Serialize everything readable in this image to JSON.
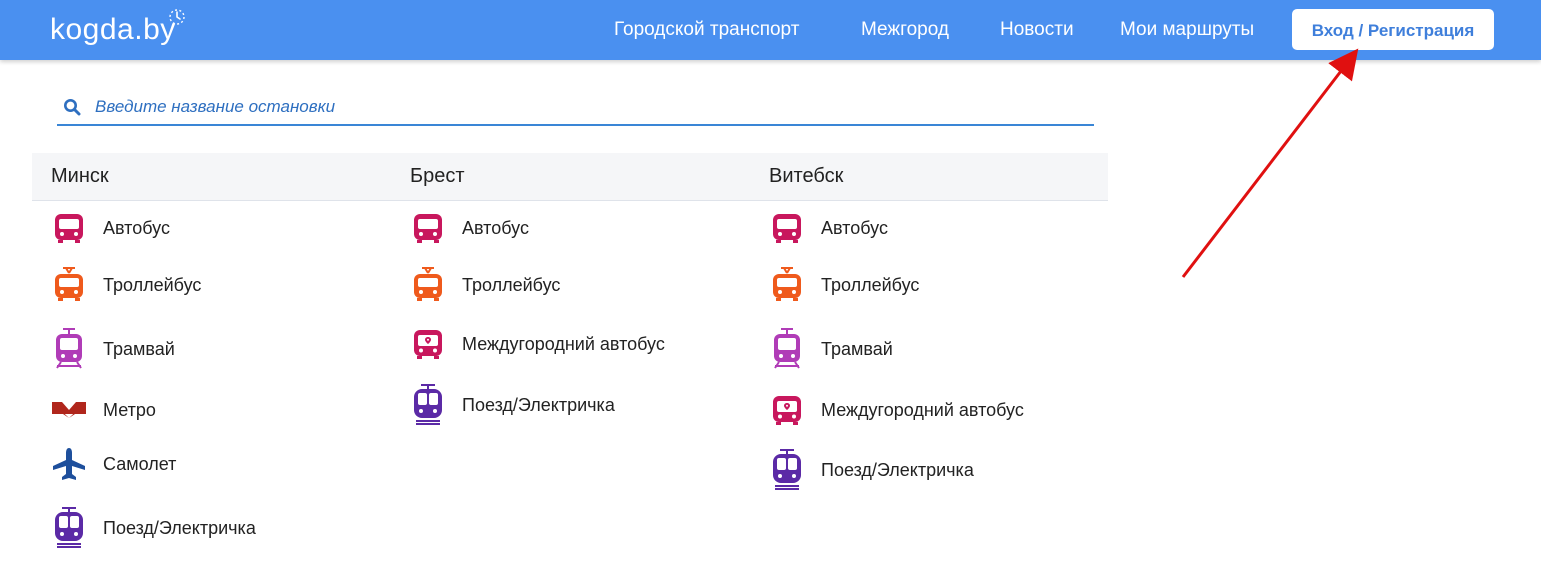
{
  "header": {
    "logo_text": "kogda.by",
    "nav": [
      "Городской транспорт",
      "Межгород",
      "Новости",
      "Мои маршруты"
    ],
    "login_button": "Вход / Регистрация"
  },
  "search": {
    "placeholder": "Введите название остановки"
  },
  "cities": [
    {
      "name": "Минск",
      "items": [
        {
          "label": "Автобус",
          "icon": "bus-icon",
          "color": "#c8175d"
        },
        {
          "label": "Троллейбус",
          "icon": "trolleybus-icon",
          "color": "#ef5a1c"
        },
        {
          "label": "Трамвай",
          "icon": "tram-icon",
          "color": "#b03cb7"
        },
        {
          "label": "Метро",
          "icon": "metro-icon",
          "color": "#b0261c"
        },
        {
          "label": "Самолет",
          "icon": "airplane-icon",
          "color": "#1e4f9c"
        },
        {
          "label": "Поезд/Электричка",
          "icon": "train-icon",
          "color": "#5b2aa6"
        }
      ]
    },
    {
      "name": "Брест",
      "items": [
        {
          "label": "Автобус",
          "icon": "bus-icon",
          "color": "#c8175d"
        },
        {
          "label": "Троллейбус",
          "icon": "trolleybus-icon",
          "color": "#ef5a1c"
        },
        {
          "label": "Междугородний автобус",
          "icon": "intercity-bus-icon",
          "color": "#c8175d"
        },
        {
          "label": "Поезд/Электричка",
          "icon": "train-icon",
          "color": "#5b2aa6"
        }
      ]
    },
    {
      "name": "Витебск",
      "items": [
        {
          "label": "Автобус",
          "icon": "bus-icon",
          "color": "#c8175d"
        },
        {
          "label": "Троллейбус",
          "icon": "trolleybus-icon",
          "color": "#ef5a1c"
        },
        {
          "label": "Трамвай",
          "icon": "tram-icon",
          "color": "#b03cb7"
        },
        {
          "label": "Междугородний автобус",
          "icon": "intercity-bus-icon",
          "color": "#c8175d"
        },
        {
          "label": "Поезд/Электричка",
          "icon": "train-icon",
          "color": "#5b2aa6"
        }
      ]
    }
  ],
  "colors": {
    "topbar": "#4a90f0",
    "accent": "#3a86d6",
    "annotation_arrow": "#e01010"
  }
}
